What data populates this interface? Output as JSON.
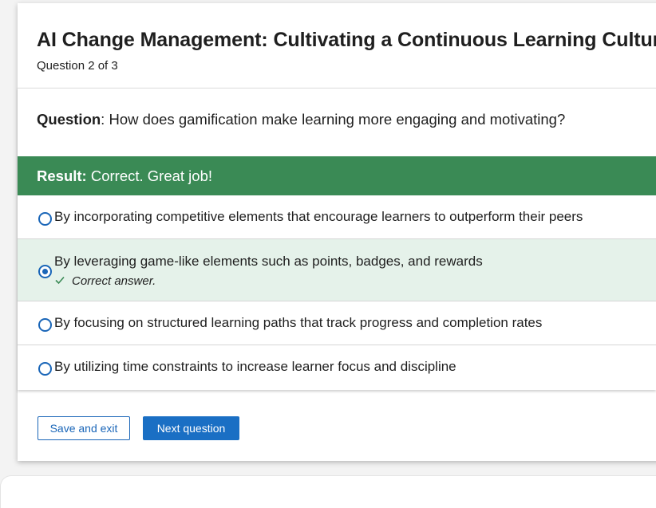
{
  "header": {
    "course_title": "AI Change Management: Cultivating a Continuous Learning Culture",
    "question_count": "Question 2 of 3"
  },
  "question": {
    "label": "Question",
    "separator": ":",
    "text": " How does gamification make learning more engaging and motivating?"
  },
  "result": {
    "label": "Result:",
    "text": " Correct. Great job!",
    "color": "#3a8a55"
  },
  "options": [
    {
      "label": "By incorporating competitive elements that encourage learners to outperform their peers",
      "selected": false
    },
    {
      "label": "By leveraging game-like elements such as points, badges, and rewards",
      "selected": true,
      "feedback": "Correct answer.",
      "feedback_icon": "check-icon"
    },
    {
      "label": "By focusing on structured learning paths that track progress and completion rates",
      "selected": false
    },
    {
      "label": "By utilizing time constraints to increase learner focus and discipline",
      "selected": false
    }
  ],
  "actions": {
    "save_exit_label": "Save and exit",
    "next_label": "Next question"
  },
  "colors": {
    "accent": "#1a6fc4",
    "selected_bg": "#e5f2ea",
    "correct_check": "#3a8a55"
  }
}
